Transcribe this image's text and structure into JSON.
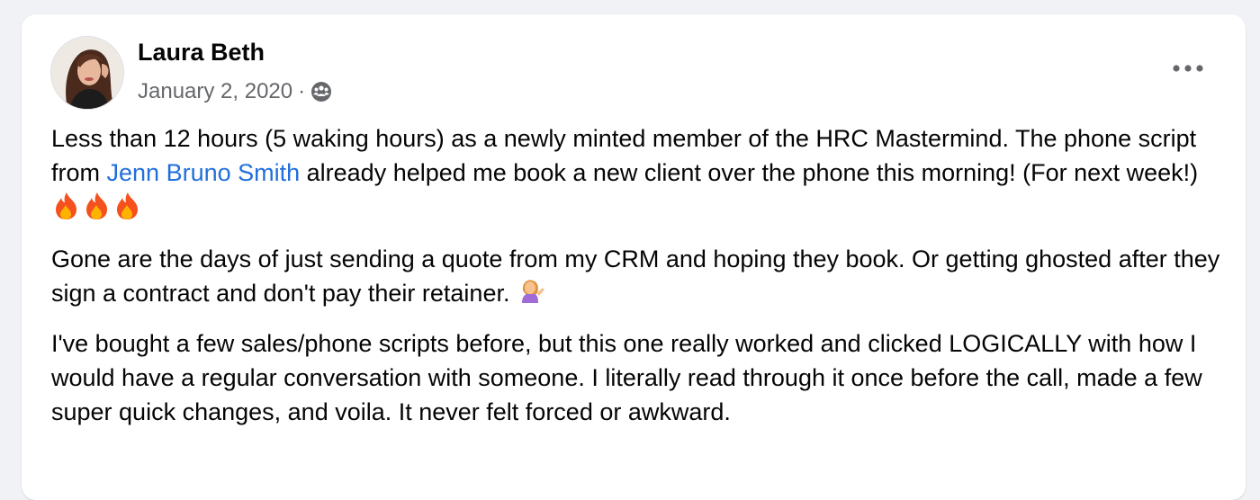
{
  "post": {
    "author": "Laura Beth",
    "date": "January 2, 2020",
    "separator": "·",
    "privacy_icon": "group-icon",
    "more_icon": "more-horizontal-icon",
    "paragraph1": {
      "text_a": "Less than 12 hours (5 waking hours) as a newly minted member of the HRC Mastermind.  The phone script from ",
      "mention": "Jenn Bruno Smith",
      "text_b": " already helped me book a new client over the phone this morning!  (For next week!) ",
      "emoji": "fire-emoji"
    },
    "paragraph2": {
      "text": "Gone are the days of just sending a quote from my CRM and hoping they book. Or getting ghosted after they sign a contract and don't pay their retainer. ",
      "emoji": "person-tipping-hand-emoji"
    },
    "paragraph3": {
      "text": "I've bought a few sales/phone scripts before, but this one really worked and clicked LOGICALLY with how I would have a regular conversation with someone. I literally read through it once before the call, made a few super quick changes, and voila. It never felt forced or awkward."
    }
  },
  "colors": {
    "mention": "#216fdb",
    "secondary_text": "#65676b",
    "background": "#f0f2f5"
  }
}
